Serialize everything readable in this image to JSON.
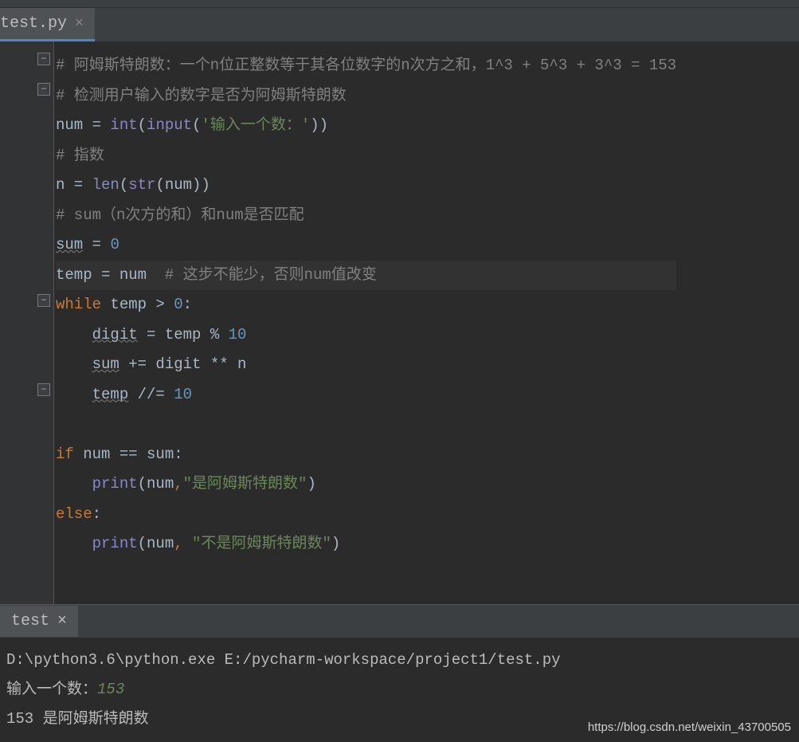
{
  "tab": {
    "filename": "test.py",
    "close": "×"
  },
  "code": {
    "l1": "# 阿姆斯特朗数：一个n位正整数等于其各位数字的n次方之和，1^3 + 5^3 + 3^3 = 153",
    "l2": "# 检测用户输入的数字是否为阿姆斯特朗数",
    "l3": {
      "a": "num = ",
      "int": "int",
      "p1": "(",
      "input": "input",
      "p2": "(",
      "s": "'输入一个数：'",
      "p3": "))"
    },
    "l4": "# 指数",
    "l5": {
      "a": "n = ",
      "len": "len",
      "p1": "(",
      "str": "str",
      "p2": "(num))"
    },
    "l6": "# sum（n次方的和）和num是否匹配",
    "l7": {
      "sum": "sum",
      "eq": " = ",
      "zero": "0"
    },
    "l8": {
      "a": "temp = num  ",
      "cmt": "# 这步不能少，否则num值改变"
    },
    "l9": {
      "while": "while",
      "sp": " temp > ",
      "zero": "0",
      "colon": ":"
    },
    "l10": {
      "indent": "    ",
      "digit": "digit",
      "eq": " = temp % ",
      "ten": "10"
    },
    "l11": {
      "indent": "    ",
      "sum": "sum",
      "rest": " += digit ** n"
    },
    "l12": {
      "indent": "    ",
      "temp": "temp",
      "op": " //= ",
      "ten": "10"
    },
    "l14": {
      "if": "if",
      "rest": " num == sum:"
    },
    "l15": {
      "indent": "    ",
      "print": "print",
      "p1": "(num",
      "comma": ",",
      "s": "\"是阿姆斯特朗数\"",
      "p2": ")"
    },
    "l16": {
      "else": "else",
      "colon": ":"
    },
    "l17": {
      "indent": "    ",
      "print": "print",
      "p1": "(num",
      "comma": ", ",
      "s": "\"不是阿姆斯特朗数\"",
      "p2": ")"
    }
  },
  "console_tab": {
    "name": "test",
    "close": "×"
  },
  "console": {
    "l1": "D:\\python3.6\\python.exe E:/pycharm-workspace/project1/test.py",
    "l2p": "输入一个数：",
    "l2i": "153",
    "l3": "153 是阿姆斯特朗数"
  },
  "watermark": "https://blog.csdn.net/weixin_43700505"
}
